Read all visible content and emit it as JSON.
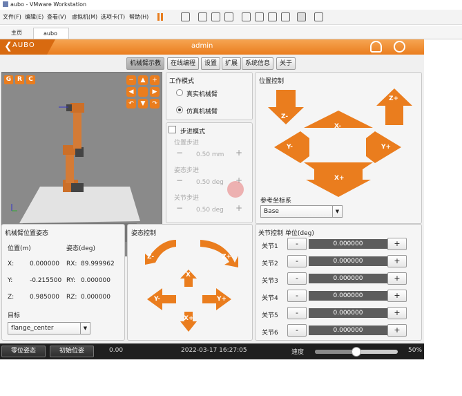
{
  "window": {
    "title": "aubo - VMware Workstation"
  },
  "menubar": {
    "items": [
      "文件(F)",
      "编辑(E)",
      "查看(V)",
      "虚拟机(M)",
      "选项卡(T)",
      "帮助(H)"
    ]
  },
  "vm_tabs": [
    {
      "label": "主页"
    },
    {
      "label": "aubo"
    }
  ],
  "header": {
    "logo": "AUBO",
    "user": "admin"
  },
  "nav_tabs": [
    "机械臂示教",
    "在线编程",
    "设置",
    "扩展",
    "系统信息",
    "关于"
  ],
  "grc": [
    "G",
    "R",
    "C"
  ],
  "work_mode": {
    "title": "工作模式",
    "options": [
      "真实机械臂",
      "仿真机械臂"
    ],
    "selected": 1
  },
  "step_mode": {
    "label": "步进模式",
    "pos_step_label": "位置步进",
    "pos_step_value": "0.50 mm",
    "att_step_label": "姿态步进",
    "att_step_value": "0.50 deg",
    "joint_step_label": "关节步进",
    "joint_step_value": "0.50 deg"
  },
  "position_control": {
    "title": "位置控制",
    "z_down": "Z-",
    "z_up": "Z+",
    "x_minus": "X-",
    "x_plus": "X+",
    "y_minus": "Y-",
    "y_plus": "Y+",
    "ref_label": "参考坐标系",
    "ref_value": "Base"
  },
  "pose": {
    "title": "机械臂位置姿态",
    "pos_header": "位置(m)",
    "att_header": "姿态(deg)",
    "rows": [
      {
        "axis": "X:",
        "pos": "0.000000",
        "rot_axis": "RX:",
        "rot": "89.999962"
      },
      {
        "axis": "Y:",
        "pos": "-0.215500",
        "rot_axis": "RY:",
        "rot": "0.000000"
      },
      {
        "axis": "Z:",
        "pos": "0.985000",
        "rot_axis": "RZ:",
        "rot": "0.000000"
      }
    ],
    "target_label": "目标",
    "target_value": "flange_center"
  },
  "attitude_control": {
    "title": "姿态控制",
    "z_minus": "Z-",
    "z_plus": "Z+",
    "x": "X",
    "y_minus": "Y-",
    "y_plus": "Y+",
    "x_plus": "X+"
  },
  "joint_control": {
    "title": "关节控制 单位(deg)",
    "joints": [
      {
        "label": "关节1",
        "value": "0.000000"
      },
      {
        "label": "关节2",
        "value": "0.000000"
      },
      {
        "label": "关节3",
        "value": "0.000000"
      },
      {
        "label": "关节4",
        "value": "0.000000"
      },
      {
        "label": "关节5",
        "value": "0.000000"
      },
      {
        "label": "关节6",
        "value": "0.000000"
      }
    ],
    "minus": "-",
    "plus": "+"
  },
  "status": {
    "zero_btn": "零位姿态",
    "init_btn": "初始位姿",
    "value": "0.00",
    "datetime": "2022-03-17 16:27:05",
    "speed_label": "速度",
    "speed_value": "50%",
    "speed_fraction": 0.5
  },
  "colors": {
    "accent": "#ea7d1e",
    "header_dark": "#d86a10"
  }
}
